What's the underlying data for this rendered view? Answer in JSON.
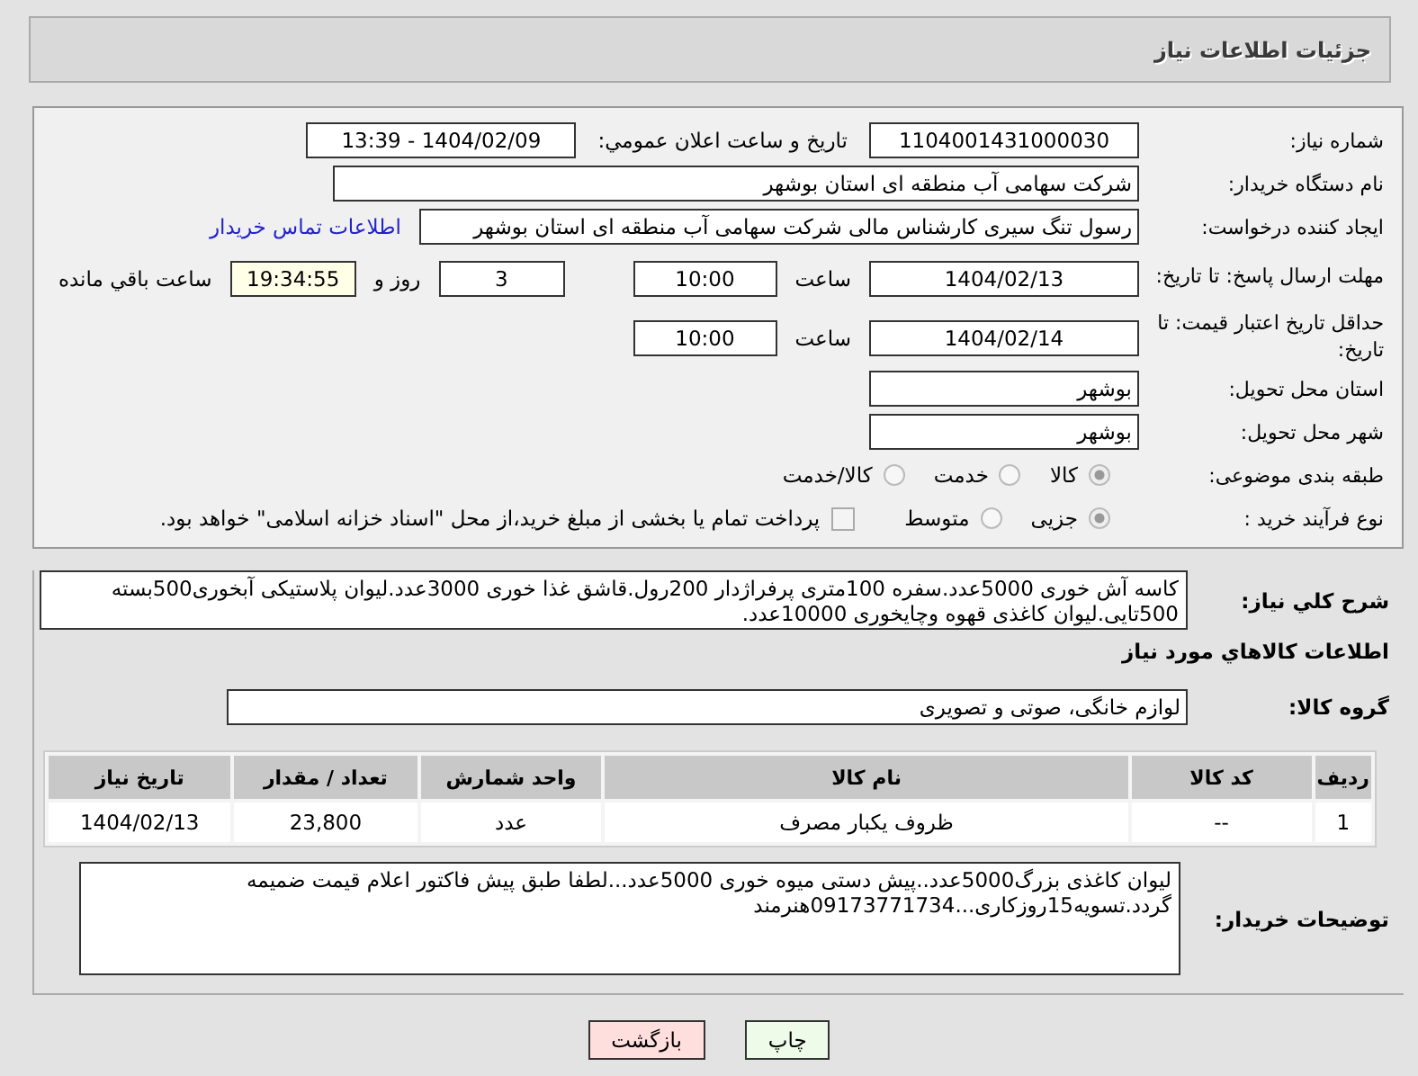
{
  "header": {
    "title": "جزئیات اطلاعات نیاز"
  },
  "need_number": {
    "label": "شماره نیاز:",
    "value": "1104001431000030"
  },
  "announce": {
    "label": "تاریخ و ساعت اعلان عمومي:",
    "value": "1404/02/09 - 13:39"
  },
  "buyer": {
    "label": "نام دستگاه خریدار:",
    "value": "شرکت سهامی آب منطقه ای استان بوشهر"
  },
  "creator": {
    "label": "ایجاد کننده درخواست:",
    "value": "رسول تنگ سیری کارشناس مالی شرکت سهامی آب منطقه ای استان بوشهر",
    "link": "اطلاعات تماس خریدار"
  },
  "deadline": {
    "label": "مهلت ارسال پاسخ: تا تاریخ:",
    "date": "1404/02/13",
    "time_label": "ساعت",
    "time": "10:00",
    "days": "3",
    "days_label": "روز و",
    "remaining": "19:34:55",
    "remaining_label": "ساعت باقي مانده"
  },
  "validity": {
    "label": "حداقل تاریخ اعتبار قیمت: تا تاریخ:",
    "date": "1404/02/14",
    "time_label": "ساعت",
    "time": "10:00"
  },
  "province": {
    "label": "استان محل تحویل:",
    "value": "بوشهر"
  },
  "city": {
    "label": "شهر محل تحویل:",
    "value": "بوشهر"
  },
  "category": {
    "label": "طبقه بندی موضوعی:",
    "options": [
      {
        "label": "کالا",
        "selected": true
      },
      {
        "label": "خدمت",
        "selected": false
      },
      {
        "label": "کالا/خدمت",
        "selected": false
      }
    ]
  },
  "process": {
    "label": "نوع فرآیند خرید :",
    "options": [
      {
        "label": "جزیی",
        "selected": true
      },
      {
        "label": "متوسط",
        "selected": false
      }
    ],
    "treasury": {
      "label": "پرداخت تمام یا بخشی از مبلغ خرید،از محل \"اسناد خزانه اسلامی\" خواهد بود.",
      "checked": false
    }
  },
  "summary": {
    "label": "شرح کلي نياز:",
    "text": "کاسه آش خوری 5000عدد.سفره 100متری پرفراژدار 200رول.قاشق غذا خوری 3000عدد.لیوان پلاستیکی آبخوری500بسته 500تایی.لیوان کاغذی قهوه وچایخوری 10000عدد."
  },
  "goods_heading": "اطلاعات کالاهاي مورد نياز",
  "goods_group": {
    "label": "گروه کالا:",
    "value": "لوازم خانگی، صوتی و تصویری"
  },
  "table": {
    "columns": [
      "ردیف",
      "کد کالا",
      "نام کالا",
      "واحد شمارش",
      "تعداد / مقدار",
      "تاریخ نیاز"
    ],
    "rows": [
      [
        "1",
        "--",
        "ظروف یکبار مصرف",
        "عدد",
        "23,800",
        "1404/02/13"
      ]
    ]
  },
  "buyer_notes": {
    "label": "توضیحات خریدار:",
    "text": "لیوان کاغذی بزرگ5000عدد..پیش دستی میوه خوری 5000عدد...لطفا طبق پیش فاکتور اعلام قیمت ضمیمه گردد.تسویه15روزکاری...09173771734هنرمند"
  },
  "buttons": [
    {
      "label": "چاپ",
      "kind": "print"
    },
    {
      "label": "بازگشت",
      "kind": "back"
    }
  ]
}
